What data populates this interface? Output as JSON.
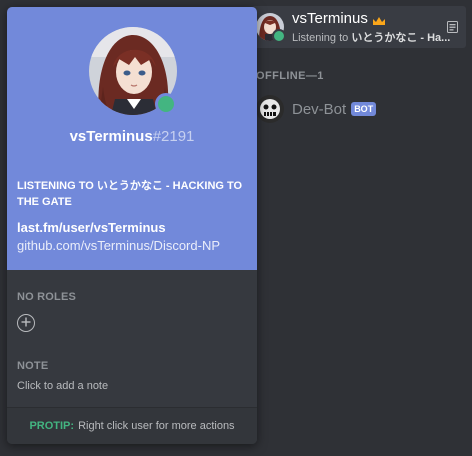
{
  "colors": {
    "accent": "#7289da",
    "online": "#43b581",
    "background": "#2f3136",
    "popout": "#36393f"
  },
  "member_list": {
    "active_member": {
      "name": "vsTerminus",
      "activity_prefix": "Listening to ",
      "activity_title": "いとうかなこ - Ha...",
      "icons": [
        "crown-icon",
        "rich-presence-icon"
      ]
    },
    "offline_header": "OFFLINE—1",
    "offline_members": [
      {
        "name": "Dev-Bot",
        "badge": "BOT"
      }
    ]
  },
  "popout": {
    "username": "vsTerminus",
    "discriminator": "#2191",
    "activity": {
      "header": "LISTENING TO いとうかなこ - HACKING TO THE GATE",
      "link1": "last.fm/user/vsTerminus",
      "link2": "github.com/vsTerminus/Discord-NP"
    },
    "roles_title": "NO ROLES",
    "note_title": "NOTE",
    "note_placeholder": "Click to add a note",
    "protip_label": "PROTIP:",
    "protip_text": "Right click user for more actions"
  }
}
